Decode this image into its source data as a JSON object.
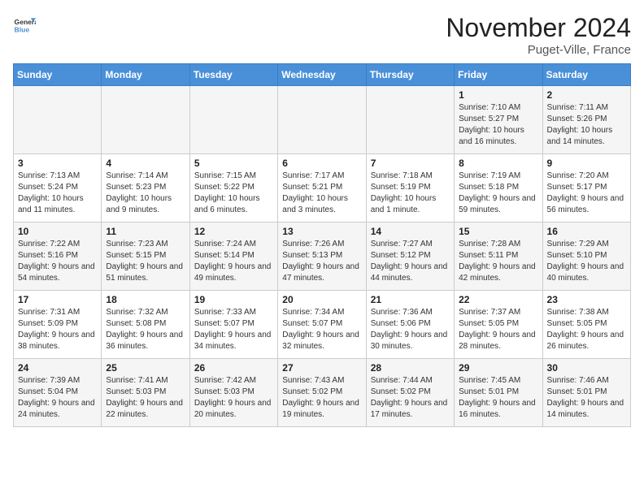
{
  "header": {
    "logo_general": "General",
    "logo_blue": "Blue",
    "title": "November 2024",
    "location": "Puget-Ville, France"
  },
  "days_of_week": [
    "Sunday",
    "Monday",
    "Tuesday",
    "Wednesday",
    "Thursday",
    "Friday",
    "Saturday"
  ],
  "weeks": [
    [
      {
        "day": "",
        "info": ""
      },
      {
        "day": "",
        "info": ""
      },
      {
        "day": "",
        "info": ""
      },
      {
        "day": "",
        "info": ""
      },
      {
        "day": "",
        "info": ""
      },
      {
        "day": "1",
        "info": "Sunrise: 7:10 AM\nSunset: 5:27 PM\nDaylight: 10 hours and 16 minutes."
      },
      {
        "day": "2",
        "info": "Sunrise: 7:11 AM\nSunset: 5:26 PM\nDaylight: 10 hours and 14 minutes."
      }
    ],
    [
      {
        "day": "3",
        "info": "Sunrise: 7:13 AM\nSunset: 5:24 PM\nDaylight: 10 hours and 11 minutes."
      },
      {
        "day": "4",
        "info": "Sunrise: 7:14 AM\nSunset: 5:23 PM\nDaylight: 10 hours and 9 minutes."
      },
      {
        "day": "5",
        "info": "Sunrise: 7:15 AM\nSunset: 5:22 PM\nDaylight: 10 hours and 6 minutes."
      },
      {
        "day": "6",
        "info": "Sunrise: 7:17 AM\nSunset: 5:21 PM\nDaylight: 10 hours and 3 minutes."
      },
      {
        "day": "7",
        "info": "Sunrise: 7:18 AM\nSunset: 5:19 PM\nDaylight: 10 hours and 1 minute."
      },
      {
        "day": "8",
        "info": "Sunrise: 7:19 AM\nSunset: 5:18 PM\nDaylight: 9 hours and 59 minutes."
      },
      {
        "day": "9",
        "info": "Sunrise: 7:20 AM\nSunset: 5:17 PM\nDaylight: 9 hours and 56 minutes."
      }
    ],
    [
      {
        "day": "10",
        "info": "Sunrise: 7:22 AM\nSunset: 5:16 PM\nDaylight: 9 hours and 54 minutes."
      },
      {
        "day": "11",
        "info": "Sunrise: 7:23 AM\nSunset: 5:15 PM\nDaylight: 9 hours and 51 minutes."
      },
      {
        "day": "12",
        "info": "Sunrise: 7:24 AM\nSunset: 5:14 PM\nDaylight: 9 hours and 49 minutes."
      },
      {
        "day": "13",
        "info": "Sunrise: 7:26 AM\nSunset: 5:13 PM\nDaylight: 9 hours and 47 minutes."
      },
      {
        "day": "14",
        "info": "Sunrise: 7:27 AM\nSunset: 5:12 PM\nDaylight: 9 hours and 44 minutes."
      },
      {
        "day": "15",
        "info": "Sunrise: 7:28 AM\nSunset: 5:11 PM\nDaylight: 9 hours and 42 minutes."
      },
      {
        "day": "16",
        "info": "Sunrise: 7:29 AM\nSunset: 5:10 PM\nDaylight: 9 hours and 40 minutes."
      }
    ],
    [
      {
        "day": "17",
        "info": "Sunrise: 7:31 AM\nSunset: 5:09 PM\nDaylight: 9 hours and 38 minutes."
      },
      {
        "day": "18",
        "info": "Sunrise: 7:32 AM\nSunset: 5:08 PM\nDaylight: 9 hours and 36 minutes."
      },
      {
        "day": "19",
        "info": "Sunrise: 7:33 AM\nSunset: 5:07 PM\nDaylight: 9 hours and 34 minutes."
      },
      {
        "day": "20",
        "info": "Sunrise: 7:34 AM\nSunset: 5:07 PM\nDaylight: 9 hours and 32 minutes."
      },
      {
        "day": "21",
        "info": "Sunrise: 7:36 AM\nSunset: 5:06 PM\nDaylight: 9 hours and 30 minutes."
      },
      {
        "day": "22",
        "info": "Sunrise: 7:37 AM\nSunset: 5:05 PM\nDaylight: 9 hours and 28 minutes."
      },
      {
        "day": "23",
        "info": "Sunrise: 7:38 AM\nSunset: 5:05 PM\nDaylight: 9 hours and 26 minutes."
      }
    ],
    [
      {
        "day": "24",
        "info": "Sunrise: 7:39 AM\nSunset: 5:04 PM\nDaylight: 9 hours and 24 minutes."
      },
      {
        "day": "25",
        "info": "Sunrise: 7:41 AM\nSunset: 5:03 PM\nDaylight: 9 hours and 22 minutes."
      },
      {
        "day": "26",
        "info": "Sunrise: 7:42 AM\nSunset: 5:03 PM\nDaylight: 9 hours and 20 minutes."
      },
      {
        "day": "27",
        "info": "Sunrise: 7:43 AM\nSunset: 5:02 PM\nDaylight: 9 hours and 19 minutes."
      },
      {
        "day": "28",
        "info": "Sunrise: 7:44 AM\nSunset: 5:02 PM\nDaylight: 9 hours and 17 minutes."
      },
      {
        "day": "29",
        "info": "Sunrise: 7:45 AM\nSunset: 5:01 PM\nDaylight: 9 hours and 16 minutes."
      },
      {
        "day": "30",
        "info": "Sunrise: 7:46 AM\nSunset: 5:01 PM\nDaylight: 9 hours and 14 minutes."
      }
    ]
  ]
}
